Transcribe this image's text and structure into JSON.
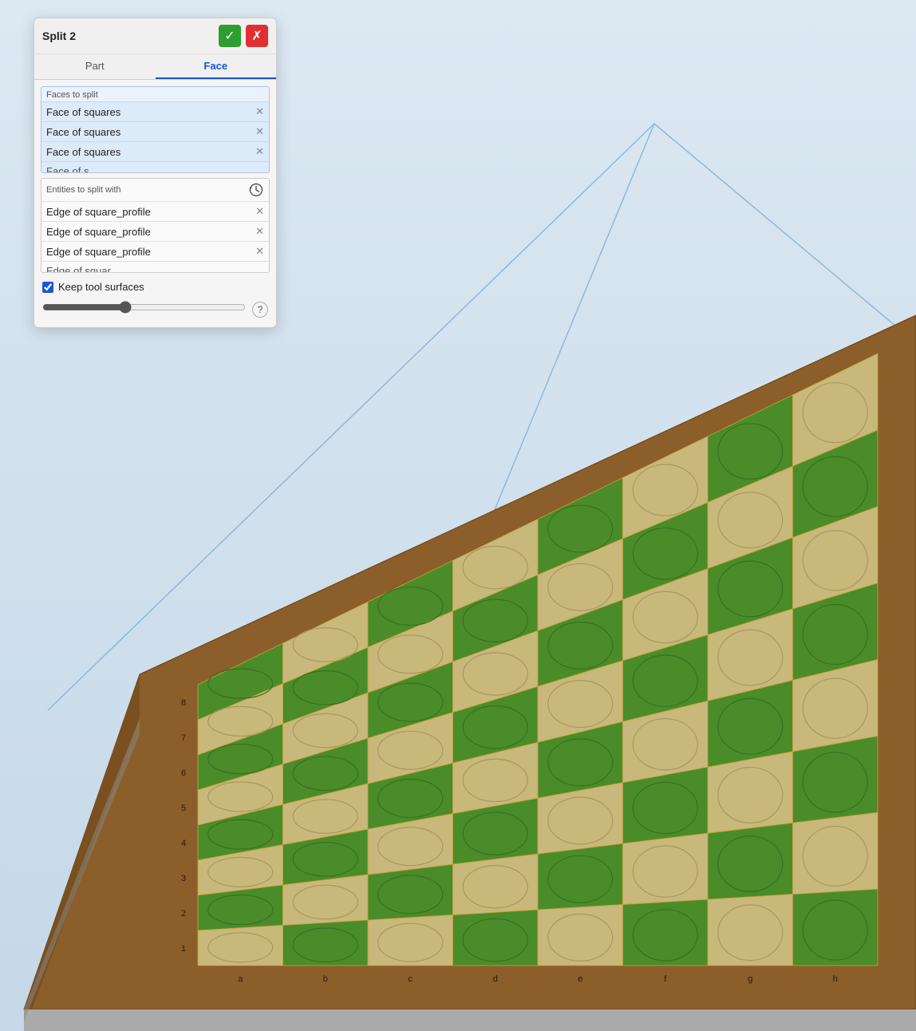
{
  "dialog": {
    "title": "Split 2",
    "confirm_label": "✓",
    "cancel_label": "✗",
    "tabs": [
      {
        "id": "part",
        "label": "Part",
        "active": false
      },
      {
        "id": "face",
        "label": "Face",
        "active": true
      }
    ],
    "faces_section": {
      "label": "Faces to split",
      "items": [
        {
          "text": "Face of squares",
          "show_x": true
        },
        {
          "text": "Face of squares",
          "show_x": true
        },
        {
          "text": "Face of squares",
          "show_x": true
        }
      ],
      "partial_item": "Face of s"
    },
    "entities_section": {
      "label": "Entities to split with",
      "items": [
        {
          "text": "Edge of square_profile",
          "show_x": true
        },
        {
          "text": "Edge of square_profile",
          "show_x": true
        },
        {
          "text": "Edge of square_profile",
          "show_x": true
        }
      ],
      "partial_item": "Edge of square_profile"
    },
    "keep_surfaces": {
      "label": "Keep tool surfaces",
      "checked": true
    },
    "slider": {
      "value": 40,
      "min": 0,
      "max": 100
    },
    "help_label": "?"
  },
  "colors": {
    "green_square": "#4a8c2a",
    "beige_square": "#c8b87a",
    "board_border": "#8b5e2a",
    "circle_stroke": "#3a7020",
    "dialog_bg": "#f5f5f5",
    "active_tab": "#1a56db",
    "faces_bg": "#ddeaf8",
    "faces_border": "#aac4e8"
  }
}
